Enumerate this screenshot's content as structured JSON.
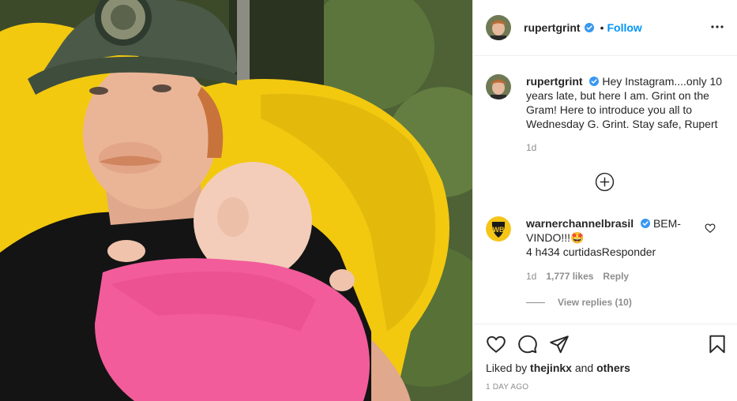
{
  "post": {
    "author": "rupertgrint",
    "follow_label": "Follow",
    "dot": "•",
    "caption": "Hey Instagram....only 10 years late, but here I am. Grint on the Gram! Here to introduce you all to Wednesday G. Grint. Stay safe, Rupert",
    "caption_time": "1d",
    "liked_by_prefix": "Liked by",
    "liked_by_user": "thejinkx",
    "liked_by_and": "and",
    "liked_by_others": "others",
    "age": "1 DAY AGO"
  },
  "comment": {
    "author": "warnerchannelbrasil",
    "text_line1": "BEM-",
    "text_line2": "VINDO!!!🤩",
    "text_line3": "4 h434 curtidasResponder",
    "time": "1d",
    "likes": "1,777 likes",
    "reply_label": "Reply",
    "view_replies": "View replies (10)"
  },
  "icons": {
    "more": "more-options-icon",
    "verified": "verified-badge-icon",
    "load_more": "load-more-comments-icon",
    "heart": "heart-icon",
    "comment": "comment-icon",
    "share": "share-icon",
    "save": "bookmark-icon"
  },
  "colors": {
    "accent": "#0095f6",
    "secondary_text": "#8e8e8e",
    "primary_text": "#262626",
    "wb_logo": "#f5c518"
  }
}
